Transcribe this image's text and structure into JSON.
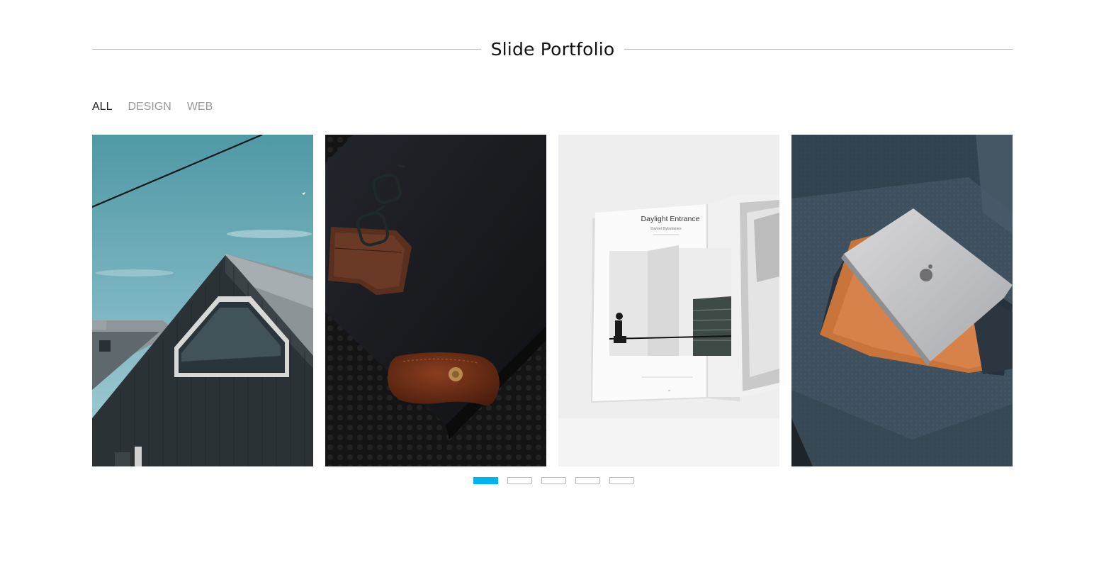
{
  "page": {
    "title": "Slide Portfolio"
  },
  "filters": [
    {
      "label": "ALL",
      "active": true
    },
    {
      "label": "DESIGN",
      "active": false
    },
    {
      "label": "WEB",
      "active": false
    }
  ],
  "slides": [
    {
      "subject": "dark wooden house with angled window against teal sky"
    },
    {
      "subject": "black notebook with glasses, leather wallet and leather case on dark mat"
    },
    {
      "subject": "open book on white background"
    },
    {
      "subject": "silver laptop on leather sleeve over grey fabric sofa"
    }
  ],
  "book": {
    "heading": "Daylight Entrance",
    "subheading": "Daniel Bylsdasies"
  },
  "pagination": {
    "count": 5,
    "active_index": 0
  },
  "colors": {
    "accent": "#00b4f0",
    "title_line": "#b8b8b8",
    "filter_inactive": "#9a9a9a",
    "filter_active": "#222222"
  },
  "icons": {
    "laptop_logo": "apple-logo-icon"
  }
}
